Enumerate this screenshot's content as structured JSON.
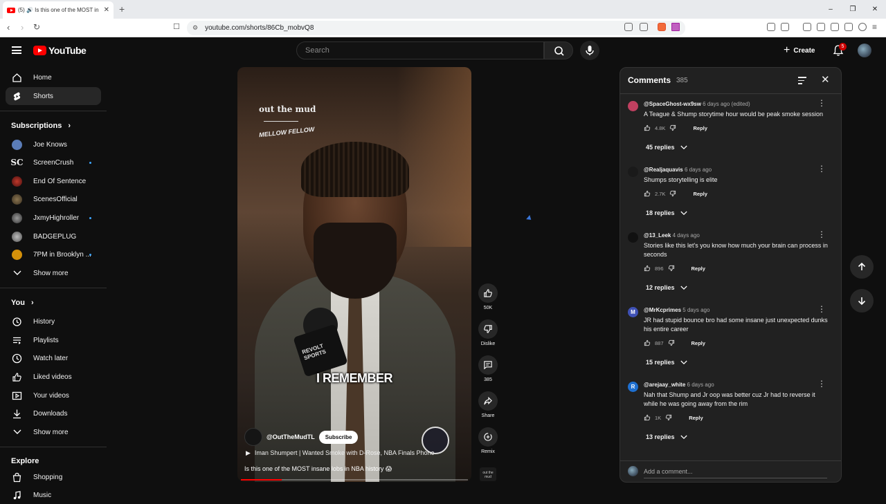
{
  "browser": {
    "tab_title": "(5) 🔊 Is this one of the MOST in",
    "new_tab": "+",
    "url": "youtube.com/shorts/86Cb_mobvQ8",
    "window_controls": [
      "–",
      "❐",
      "✕"
    ]
  },
  "header": {
    "logo": "YouTube",
    "search_placeholder": "Search",
    "create_label": "Create",
    "notification_count": "5"
  },
  "sidebar": {
    "primary": [
      {
        "label": "Home",
        "icon": "home-icon"
      },
      {
        "label": "Shorts",
        "icon": "shorts-icon",
        "active": true
      }
    ],
    "subscriptions_title": "Subscriptions",
    "subscriptions": [
      {
        "label": "Joe Knows",
        "color": "#5b7db8",
        "dot": false
      },
      {
        "label": "ScreenCrush",
        "color": "#0f0f0f",
        "dot": true,
        "text": "SC"
      },
      {
        "label": "End Of Sentence",
        "color": "#8b2020",
        "dot": false
      },
      {
        "label": "ScenesOfficial",
        "color": "#5a4a30",
        "dot": false
      },
      {
        "label": "JxmyHighroller",
        "color": "#444444",
        "dot": true
      },
      {
        "label": "BADGEPLUG",
        "color": "#666666",
        "dot": false
      },
      {
        "label": "7PM in Brooklyn ...",
        "color": "#d4900a",
        "dot": true
      }
    ],
    "show_more_1": "Show more",
    "you_title": "You",
    "you_items": [
      {
        "label": "History",
        "icon": "history-icon"
      },
      {
        "label": "Playlists",
        "icon": "playlists-icon"
      },
      {
        "label": "Watch later",
        "icon": "watch-later-icon"
      },
      {
        "label": "Liked videos",
        "icon": "liked-videos-icon"
      },
      {
        "label": "Your videos",
        "icon": "your-videos-icon"
      },
      {
        "label": "Downloads",
        "icon": "downloads-icon"
      }
    ],
    "show_more_2": "Show more",
    "explore_title": "Explore",
    "explore_items": [
      {
        "label": "Shopping",
        "icon": "shopping-icon"
      },
      {
        "label": "Music",
        "icon": "music-icon"
      }
    ]
  },
  "video": {
    "brand_line1": "out the mud",
    "brand_line2": "MELLOW FELLOW",
    "mic_brand": "REVOLT SPORTS",
    "caption": "I REMEMBER",
    "channel_handle": "@OutTheMudTL",
    "subscribe_label": "Subscribe",
    "linked_video": "Iman Shumpert | Wanted Smoke with D-Rose, NBA Finals Phone",
    "title": "Is this one of the MOST insane lobs in NBA history 😱",
    "progress": 0.18
  },
  "actions": {
    "likes": "50K",
    "dislike": "Dislike",
    "comments": "385",
    "share": "Share",
    "remix": "Remix",
    "thumb_text": "out the mud"
  },
  "comments_panel": {
    "title": "Comments",
    "count": "385",
    "add_placeholder": "Add a comment...",
    "comments": [
      {
        "author": "@SpaceGhost-wx9sw",
        "time": "6 days ago (edited)",
        "text": "A Teague & Shump storytime hour would be peak smoke session",
        "likes": "4.8K",
        "reply": "Reply",
        "replies": "45 replies",
        "avatar_color": "#c04060",
        "avatar_text": ""
      },
      {
        "author": "@Realjaquavis",
        "time": "6 days ago",
        "text": "Shumps storytelling is elite",
        "likes": "2.7K",
        "reply": "Reply",
        "replies": "18 replies",
        "avatar_color": "#1a1a1a",
        "avatar_text": ""
      },
      {
        "author": "@13_Leek",
        "time": "4 days ago",
        "text": "Stories like this let's you know how much your brain can process in seconds",
        "likes": "896",
        "reply": "Reply",
        "replies": "12 replies",
        "avatar_color": "#111111",
        "avatar_text": ""
      },
      {
        "author": "@MrKcprimes",
        "time": "5 days ago",
        "text": "JR had stupid bounce bro had some insane just unexpected dunks his entire career",
        "likes": "887",
        "reply": "Reply",
        "replies": "15 replies",
        "avatar_color": "#3f51b5",
        "avatar_text": "M"
      },
      {
        "author": "@arejaay_white",
        "time": "6 days ago",
        "text": "Nah that Shump and Jr oop was better cuz Jr had to reverse it while he was going away from the rim",
        "likes": "1K",
        "reply": "Reply",
        "replies": "13 replies",
        "avatar_color": "#1e6fd0",
        "avatar_text": "R"
      }
    ]
  }
}
